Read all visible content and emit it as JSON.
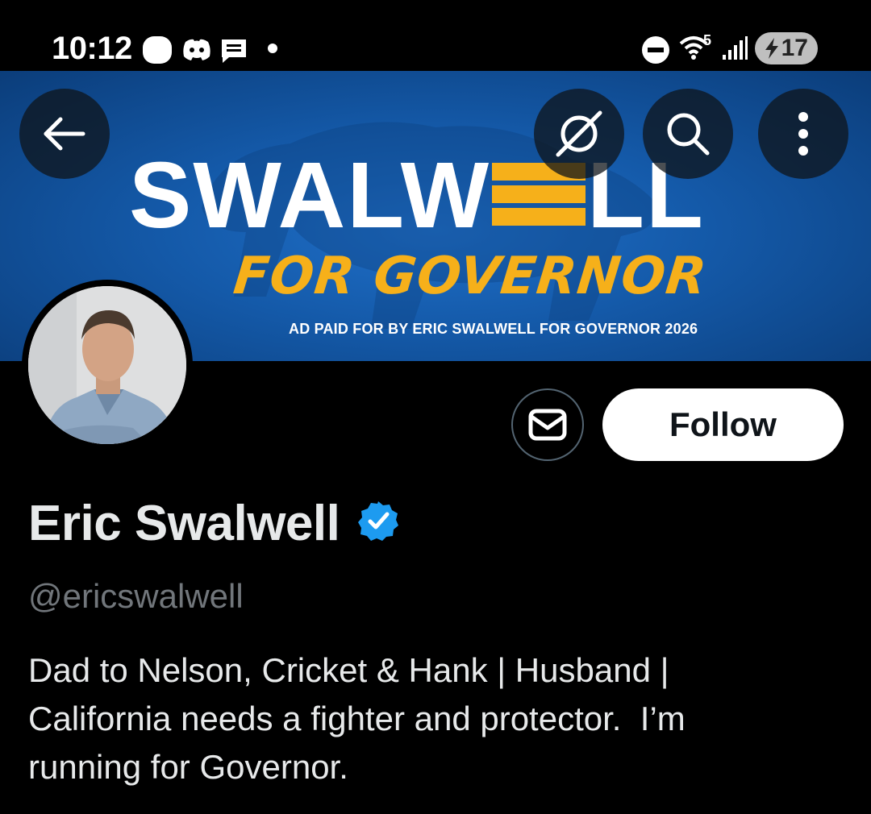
{
  "status_bar": {
    "time": "10:12",
    "icons": [
      "app-icon",
      "discord-icon",
      "message-icon",
      "notification-dot",
      "dnd-icon",
      "wifi-icon",
      "signal-icon"
    ],
    "wifi_label": "5",
    "battery_level": "17"
  },
  "header": {
    "back_icon": "arrow-left-icon",
    "grok_icon": "grok-icon",
    "search_icon": "search-icon",
    "more_icon": "more-vertical-icon"
  },
  "banner": {
    "title_part1": "SWALW",
    "title_part2": "LL",
    "subtitle": "FOR GOVERNOR",
    "fine_print": "AD PAID FOR BY ERIC SWALWELL FOR GOVERNOR 2026",
    "colors": {
      "blue": "#1459a8",
      "gold": "#f6b01a"
    }
  },
  "profile": {
    "name": "Eric Swalwell",
    "verified": true,
    "handle": "@ericswalwell",
    "bio_line1": "Dad to Nelson, Cricket & Hank | Husband |",
    "bio_line2": "California needs a fighter and protector.  I’m",
    "bio_line3": "running for Governor."
  },
  "actions": {
    "message_icon": "envelope-icon",
    "follow_label": "Follow"
  },
  "colors": {
    "background": "#000000",
    "text": "#e7e9ea",
    "secondary_text": "#71767b",
    "verified_blue": "#1d9bf0"
  }
}
